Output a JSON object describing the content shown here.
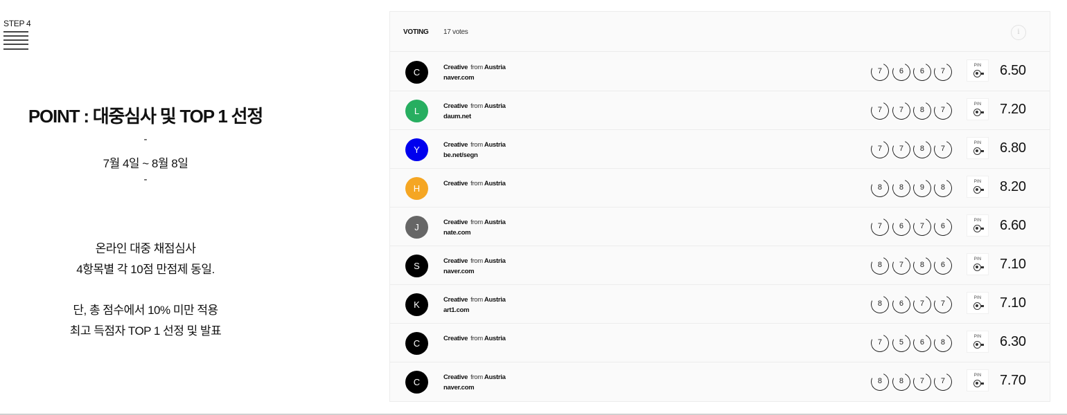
{
  "step": "STEP 4",
  "point_title": "POINT : 대중심사 및 TOP 1 선정",
  "dash": "-",
  "period": "7월 4일 ~ 8월 8일",
  "description": [
    "온라인 대중 채점심사",
    "4항목별 각 10점 만점제 동일.",
    "단, 총 점수에서 10% 미만 적용",
    "최고 득점자 TOP 1 선정 및 발표"
  ],
  "voting": {
    "label": "VOTING",
    "count": "17 votes",
    "info_icon": "i",
    "rows": [
      {
        "initial": "C",
        "color": "#000000",
        "role": "Creative",
        "from": "from",
        "country": "Austria",
        "site": "naver.com",
        "scores": [
          "7",
          "6",
          "6",
          "7"
        ],
        "pin": "PIN",
        "avg": "6.50"
      },
      {
        "initial": "L",
        "color": "#27ae60",
        "role": "Creative",
        "from": "from",
        "country": "Austria",
        "site": "daum.net",
        "scores": [
          "7",
          "7",
          "8",
          "7"
        ],
        "pin": "PIN",
        "avg": "7.20"
      },
      {
        "initial": "Y",
        "color": "#0000ee",
        "role": "Creative",
        "from": "from",
        "country": "Austria",
        "site": "be.net/segn",
        "scores": [
          "7",
          "7",
          "8",
          "7"
        ],
        "pin": "PIN",
        "avg": "6.80"
      },
      {
        "initial": "H",
        "color": "#f5a623",
        "role": "Creative",
        "from": "from",
        "country": "Austria",
        "site": "",
        "scores": [
          "8",
          "8",
          "9",
          "8"
        ],
        "pin": "PIN",
        "avg": "8.20"
      },
      {
        "initial": "J",
        "color": "#666666",
        "role": "Creative",
        "from": "from",
        "country": "Austria",
        "site": "nate.com",
        "scores": [
          "7",
          "6",
          "7",
          "6"
        ],
        "pin": "PIN",
        "avg": "6.60"
      },
      {
        "initial": "S",
        "color": "#000000",
        "role": "Creative",
        "from": "from",
        "country": "Austria",
        "site": "naver.com",
        "scores": [
          "8",
          "7",
          "8",
          "6"
        ],
        "pin": "PIN",
        "avg": "7.10"
      },
      {
        "initial": "K",
        "color": "#000000",
        "role": "Creative",
        "from": "from",
        "country": "Austria",
        "site": "art1.com",
        "scores": [
          "8",
          "6",
          "7",
          "7"
        ],
        "pin": "PIN",
        "avg": "7.10"
      },
      {
        "initial": "C",
        "color": "#000000",
        "role": "Creative",
        "from": "from",
        "country": "Austria",
        "site": "",
        "scores": [
          "7",
          "5",
          "6",
          "8"
        ],
        "pin": "PIN",
        "avg": "6.30"
      },
      {
        "initial": "C",
        "color": "#000000",
        "role": "Creative",
        "from": "from",
        "country": "Austria",
        "site": "naver.com",
        "scores": [
          "8",
          "8",
          "7",
          "7"
        ],
        "pin": "PIN",
        "avg": "7.70"
      }
    ]
  }
}
